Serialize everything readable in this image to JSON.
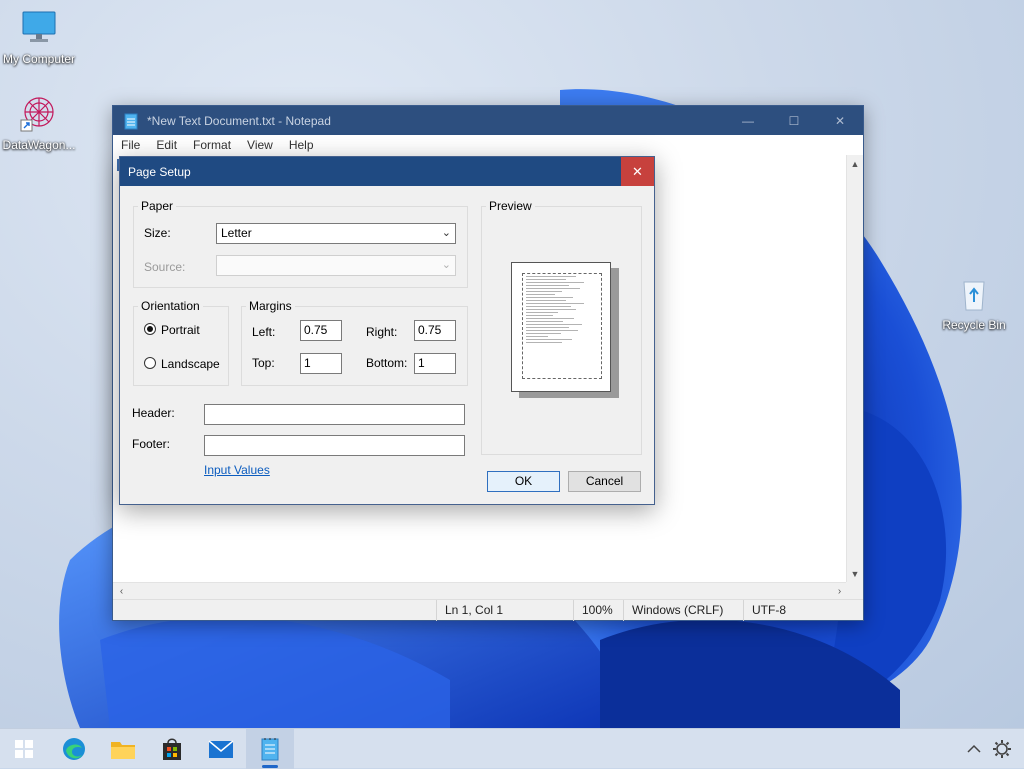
{
  "desktop": {
    "icons": [
      {
        "label": "My Computer"
      },
      {
        "label": "DataWagon..."
      },
      {
        "label": "Recycle Bin"
      }
    ]
  },
  "notepad": {
    "title": "*New Text Document.txt - Notepad",
    "menu": [
      "File",
      "Edit",
      "Format",
      "View",
      "Help"
    ],
    "controls": {
      "minimize": "—",
      "maximize": "☐",
      "close": "✕"
    },
    "status": {
      "position": "Ln 1, Col 1",
      "zoom": "100%",
      "line_ending": "Windows (CRLF)",
      "encoding": "UTF-8"
    }
  },
  "dialog": {
    "title": "Page Setup",
    "close": "✕",
    "paper": {
      "group_label": "Paper",
      "size_label": "Size:",
      "size_value": "Letter",
      "source_label": "Source:",
      "source_value": ""
    },
    "orientation": {
      "group_label": "Orientation",
      "portrait": "Portrait",
      "landscape": "Landscape",
      "selected": "portrait"
    },
    "margins": {
      "group_label": "Margins",
      "left_label": "Left:",
      "left_value": "0.75",
      "right_label": "Right:",
      "right_value": "0.75",
      "top_label": "Top:",
      "top_value": "1",
      "bottom_label": "Bottom:",
      "bottom_value": "1"
    },
    "header_label": "Header:",
    "header_value": "",
    "footer_label": "Footer:",
    "footer_value": "",
    "input_values_link": "Input Values",
    "preview_label": "Preview",
    "ok": "OK",
    "cancel": "Cancel"
  },
  "taskbar": {
    "items": [
      "start",
      "edge",
      "file-explorer",
      "store",
      "mail",
      "notepad"
    ],
    "active": "notepad"
  },
  "colors": {
    "dialog_title": "#1f4a82",
    "close_red": "#c7413d",
    "link": "#0b5cbf",
    "wallpaper_blue": "#1a4fd6"
  }
}
